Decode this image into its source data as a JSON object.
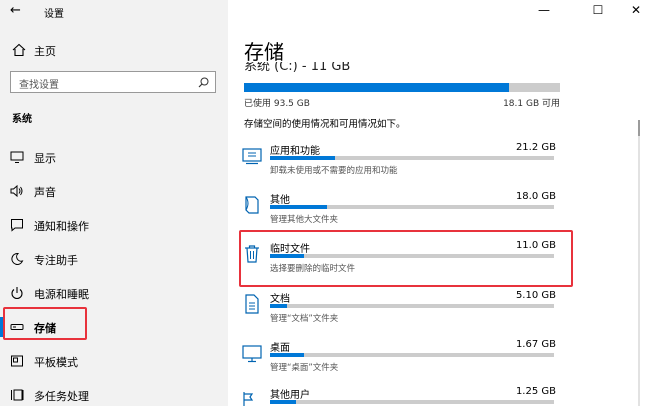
{
  "app": {
    "title": "设置"
  },
  "sidebar": {
    "home_label": "主页",
    "search_placeholder": "查找设置",
    "section_title": "系统",
    "items": [
      {
        "label": "显示",
        "icon": "display-icon"
      },
      {
        "label": "声音",
        "icon": "sound-icon"
      },
      {
        "label": "通知和操作",
        "icon": "notification-icon"
      },
      {
        "label": "专注助手",
        "icon": "moon-icon"
      },
      {
        "label": "电源和睡眠",
        "icon": "power-icon"
      },
      {
        "label": "存储",
        "icon": "storage-icon",
        "active": true
      },
      {
        "label": "平板模式",
        "icon": "tablet-icon"
      },
      {
        "label": "多任务处理",
        "icon": "multitask-icon"
      }
    ]
  },
  "main": {
    "title": "存储",
    "drive_label": "系统 (C:) - 11 GB",
    "used_label": "已使用 93.5 GB",
    "free_label": "18.1 GB 可用",
    "used_fraction": 0.84,
    "description": "存储空间的使用情况和可用情况如下。",
    "categories": [
      {
        "name": "应用和功能",
        "size": "21.2 GB",
        "desc": "卸载未使用或不需要的应用和功能",
        "fill": 0.23,
        "icon": "apps-icon"
      },
      {
        "name": "其他",
        "size": "18.0 GB",
        "desc": "管理其他大文件夹",
        "fill": 0.2,
        "icon": "other-icon"
      },
      {
        "name": "临时文件",
        "size": "11.0 GB",
        "desc": "选择要删除的临时文件",
        "fill": 0.12,
        "icon": "trash-icon"
      },
      {
        "name": "文档",
        "size": "5.10 GB",
        "desc": "管理“文档”文件夹",
        "fill": 0.06,
        "icon": "documents-icon"
      },
      {
        "name": "桌面",
        "size": "1.67 GB",
        "desc": "管理“桌面”文件夹",
        "fill": 0.12,
        "icon": "desktop-icon"
      },
      {
        "name": "其他用户",
        "size": "1.25 GB",
        "desc": "",
        "fill": 0.09,
        "icon": "users-icon"
      }
    ]
  },
  "window_controls": {
    "minimize": "—",
    "maximize": "☐",
    "close": "✕"
  },
  "colors": {
    "accent": "#0078d7",
    "highlight": "#e8323c"
  }
}
